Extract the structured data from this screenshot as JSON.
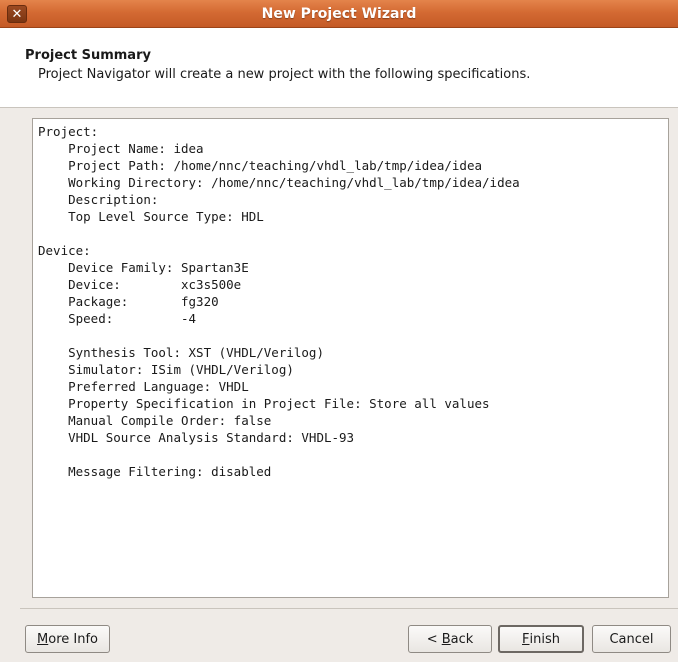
{
  "window": {
    "title": "New Project Wizard",
    "close_glyph": "✕"
  },
  "header": {
    "title": "Project Summary",
    "subtitle": "Project Navigator will create a new project with the following specifications."
  },
  "summary": {
    "lines": [
      "Project:",
      "    Project Name: idea",
      "    Project Path: /home/nnc/teaching/vhdl_lab/tmp/idea/idea",
      "    Working Directory: /home/nnc/teaching/vhdl_lab/tmp/idea/idea",
      "    Description:",
      "    Top Level Source Type: HDL",
      "",
      "Device:",
      "    Device Family: Spartan3E",
      "    Device:        xc3s500e",
      "    Package:       fg320",
      "    Speed:         -4",
      "",
      "    Synthesis Tool: XST (VHDL/Verilog)",
      "    Simulator: ISim (VHDL/Verilog)",
      "    Preferred Language: VHDL",
      "    Property Specification in Project File: Store all values",
      "    Manual Compile Order: false",
      "    VHDL Source Analysis Standard: VHDL-93",
      "",
      "    Message Filtering: disabled"
    ]
  },
  "buttons": {
    "more_info": {
      "mnemonic": "M",
      "rest": "ore Info"
    },
    "back": {
      "prefix": "< ",
      "mnemonic": "B",
      "rest": "ack"
    },
    "finish": {
      "mnemonic": "F",
      "rest": "inish"
    },
    "cancel": {
      "label": "Cancel"
    }
  },
  "colors": {
    "titlebar": "#d46a33",
    "window_bg": "#efebe7",
    "panel_bg": "#ffffff"
  }
}
